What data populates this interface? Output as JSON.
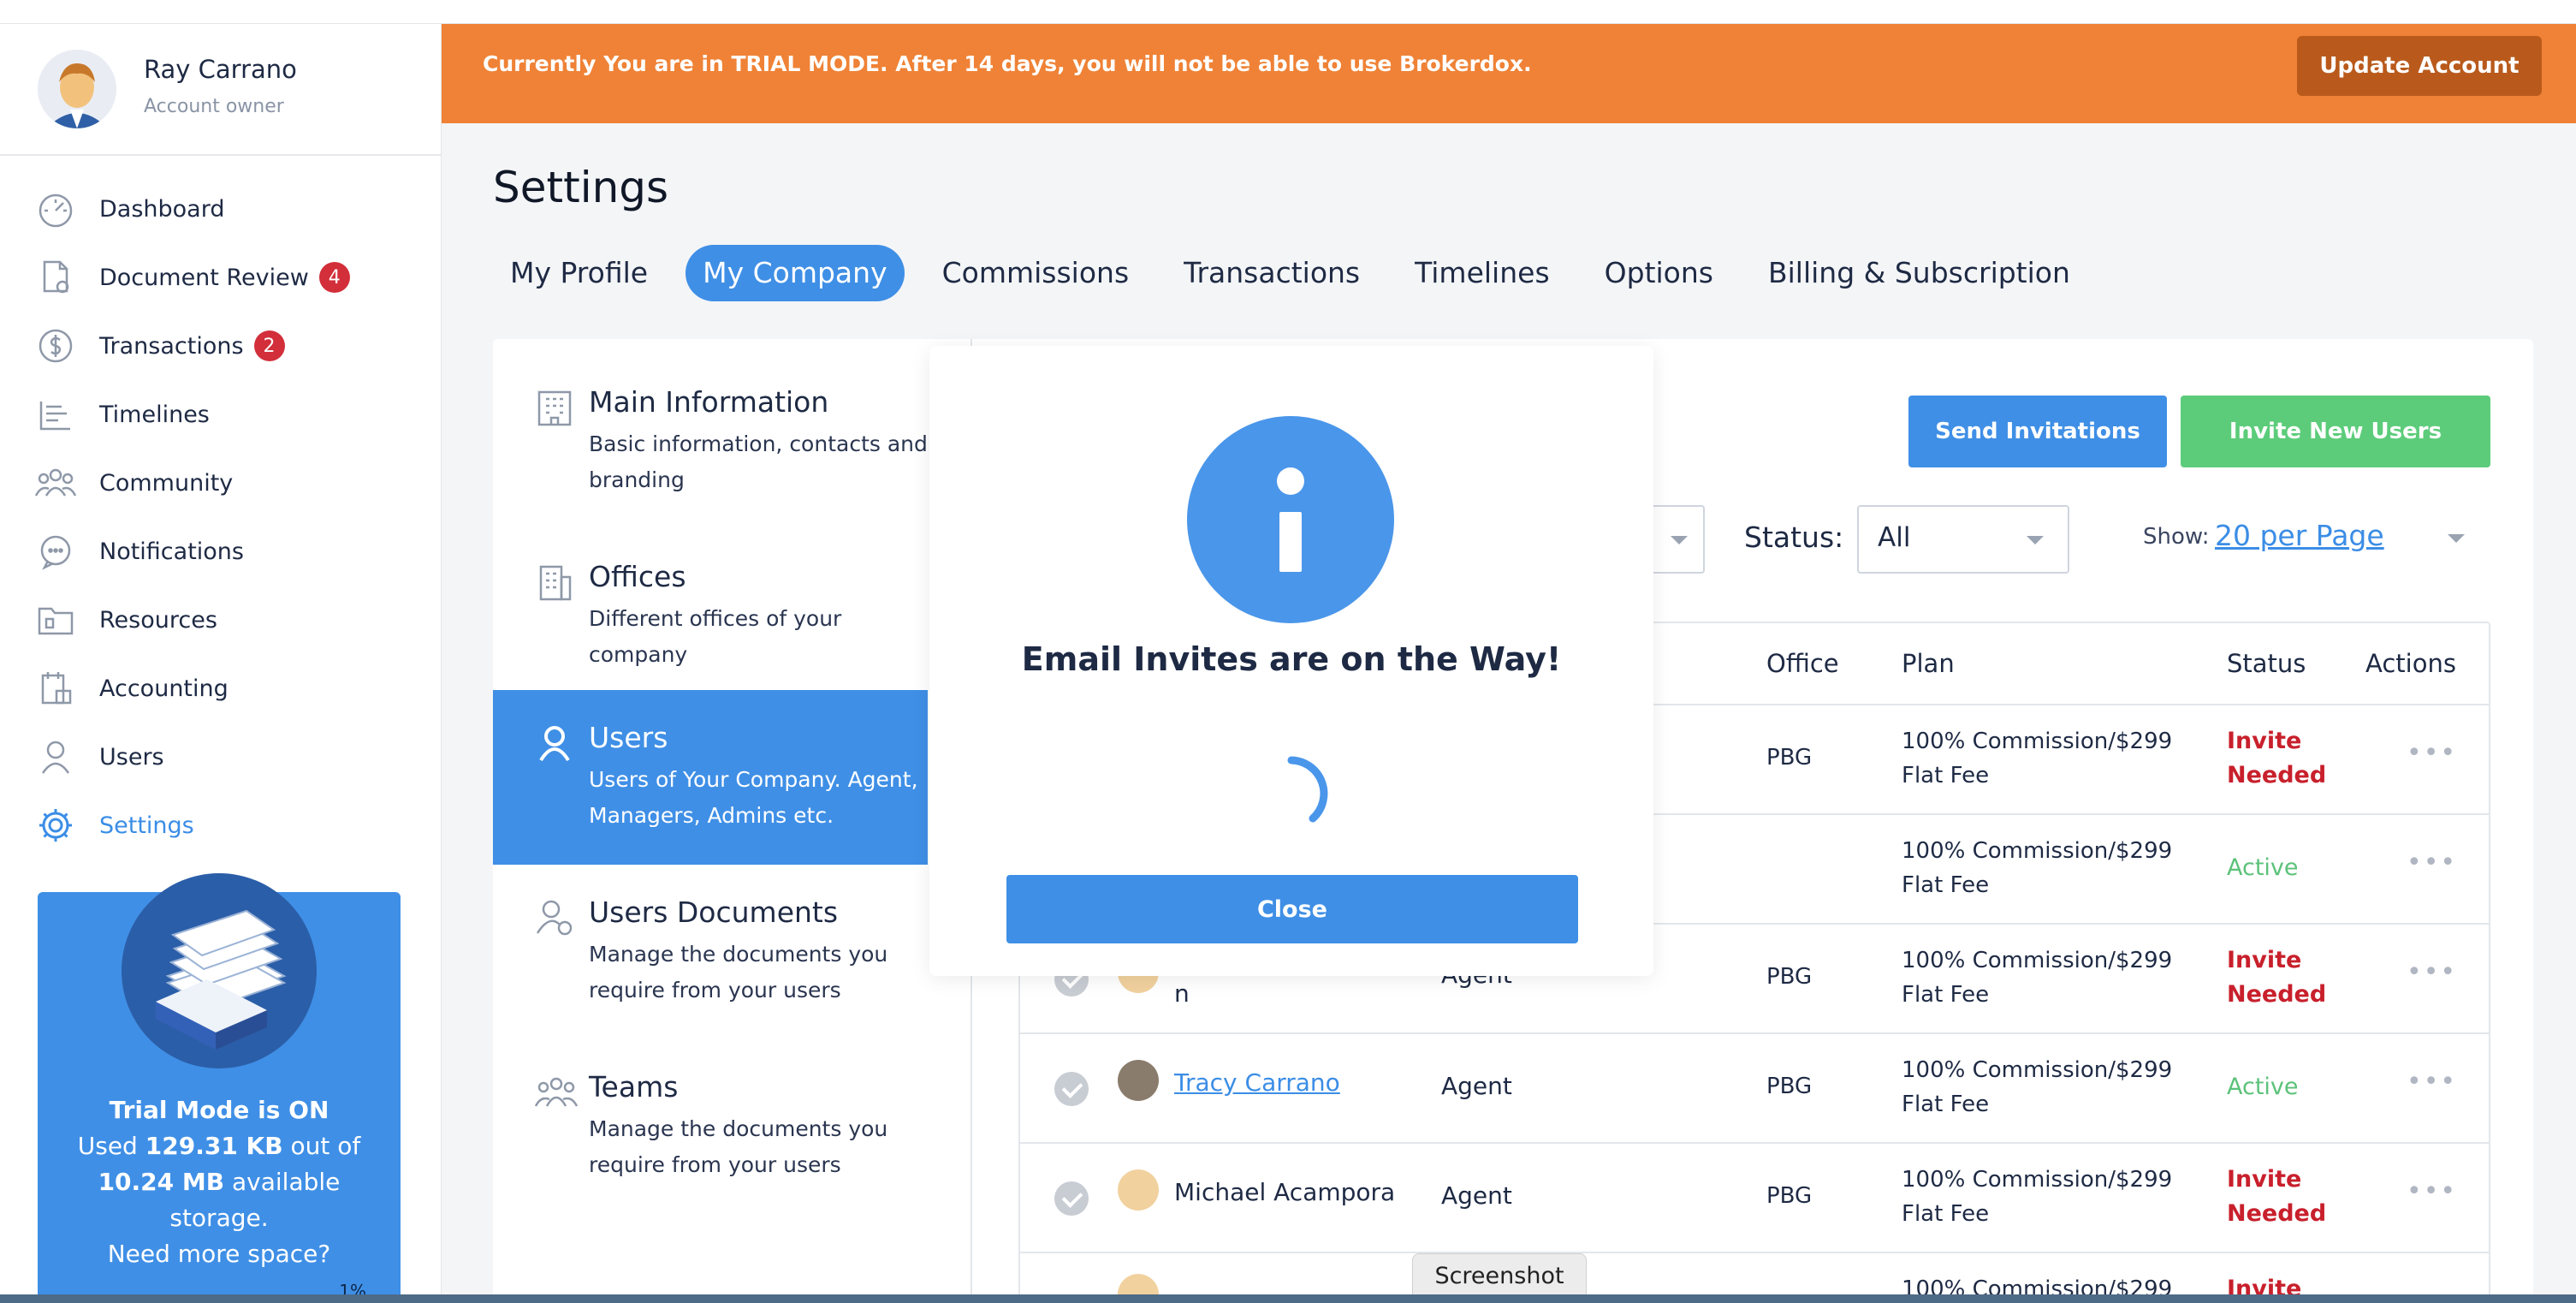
{
  "user": {
    "name": "Ray Carrano",
    "role": "Account owner"
  },
  "banner": {
    "text": "Currently You are in TRIAL MODE. After 14 days, you will not be able to use Brokerdox.",
    "button": "Update Account"
  },
  "sidebar": {
    "items": [
      {
        "label": "Dashboard",
        "icon": "dashboard-icon",
        "badge": ""
      },
      {
        "label": "Document Review",
        "icon": "document-review-icon",
        "badge": "4"
      },
      {
        "label": "Transactions",
        "icon": "transactions-icon",
        "badge": "2"
      },
      {
        "label": "Timelines",
        "icon": "timelines-icon",
        "badge": ""
      },
      {
        "label": "Community",
        "icon": "community-icon",
        "badge": ""
      },
      {
        "label": "Notifications",
        "icon": "notifications-icon",
        "badge": ""
      },
      {
        "label": "Resources",
        "icon": "resources-icon",
        "badge": ""
      },
      {
        "label": "Accounting",
        "icon": "accounting-icon",
        "badge": ""
      },
      {
        "label": "Users",
        "icon": "users-icon",
        "badge": ""
      },
      {
        "label": "Settings",
        "icon": "settings-icon",
        "badge": ""
      }
    ]
  },
  "trial": {
    "title": "Trial Mode is ON",
    "used_prefix": "Used",
    "used": "129.31 KB",
    "out_of": "out of",
    "total": "10.24 MB",
    "available": "available",
    "storage": "storage.",
    "need_more": "Need more space?",
    "percent": "1%"
  },
  "page": {
    "title": "Settings"
  },
  "tabs": [
    "My Profile",
    "My Company",
    "Commissions",
    "Transactions",
    "Timelines",
    "Options",
    "Billing & Subscription"
  ],
  "submenu": [
    {
      "title": "Main Information",
      "desc": "Basic information, contacts and branding"
    },
    {
      "title": "Offices",
      "desc": "Different offices of your company"
    },
    {
      "title": "Users",
      "desc": "Users of Your Company. Agent, Managers, Admins etc."
    },
    {
      "title": "Users Documents",
      "desc": "Manage the documents you require from your users"
    },
    {
      "title": "Teams",
      "desc": "Manage the documents you require from your users"
    }
  ],
  "actions": {
    "send": "Send Invitations",
    "invite": "Invite New Users"
  },
  "filters": {
    "status_label": "Status:",
    "status_value": "All",
    "show_label": "Show:",
    "show_value": "20 per Page"
  },
  "table": {
    "headers": {
      "office": "Office",
      "plan": "Plan",
      "status": "Status",
      "actions": "Actions"
    },
    "rows": [
      {
        "name": "",
        "role": "",
        "office": "PBG",
        "plan": "100% Commission/$299 Flat Fee",
        "status": "Invite Needed",
        "status_type": "needed"
      },
      {
        "name": "",
        "role": "",
        "office": "",
        "plan": "100% Commission/$299 Flat Fee",
        "status": "Active",
        "status_type": "active"
      },
      {
        "name": "n",
        "role": "Agent",
        "office": "PBG",
        "plan": "100% Commission/$299 Flat Fee",
        "status": "Invite Needed",
        "status_type": "needed"
      },
      {
        "name": "Tracy Carrano",
        "role": "Agent",
        "office": "PBG",
        "plan": "100% Commission/$299 Flat Fee",
        "status": "Active",
        "status_type": "active"
      },
      {
        "name": "Michael Acampora",
        "role": "Agent",
        "office": "PBG",
        "plan": "100% Commission/$299 Flat Fee",
        "status": "Invite Needed",
        "status_type": "needed"
      },
      {
        "name": "",
        "role": "",
        "office": "",
        "plan": "100% Commission/$299",
        "status": "Invite",
        "status_type": "needed"
      }
    ]
  },
  "modal": {
    "title": "Email Invites are on the Way!",
    "close": "Close"
  },
  "tooltip": "Screenshot",
  "colors": {
    "accent": "#3f8fe6",
    "banner": "#ef8236",
    "success": "#5ccc7a",
    "danger": "#c8202c"
  }
}
